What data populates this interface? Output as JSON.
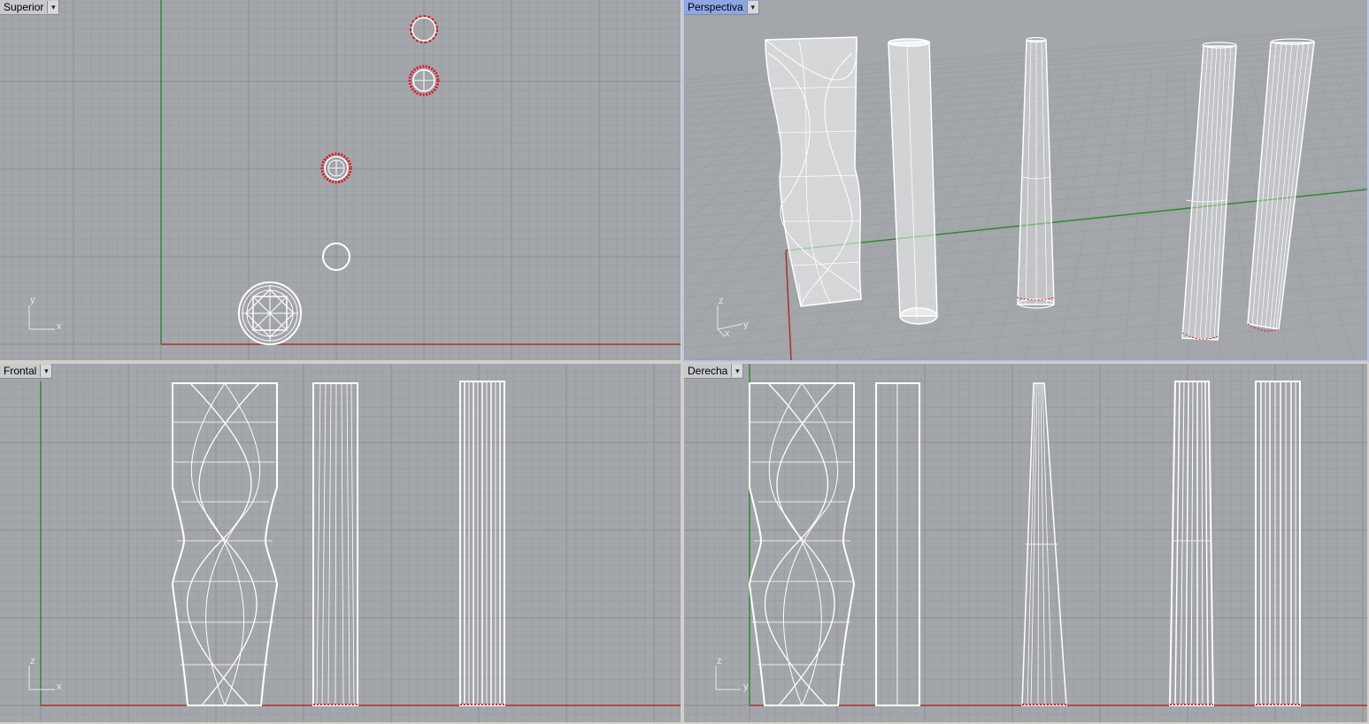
{
  "viewports": {
    "top": {
      "title": "Superior"
    },
    "persp": {
      "title": "Perspectiva"
    },
    "front": {
      "title": "Frontal"
    },
    "right": {
      "title": "Derecha"
    }
  },
  "axis_labels": {
    "top": {
      "a": "y",
      "b": "x"
    },
    "persp": {
      "a": "z",
      "b": "y",
      "c": "x"
    },
    "front": {
      "a": "z",
      "b": "x"
    },
    "right": {
      "a": "z",
      "b": "y"
    }
  },
  "dropdown_glyph": "▾",
  "colors": {
    "viewport_bg": "#a3a6ab",
    "grid_minor": "#999ca1",
    "grid_major": "#8c8f94",
    "x_axis": "#a8322b",
    "y_axis": "#2f8a2f",
    "geometry": "#ffffff",
    "selection": "#e0141c",
    "active_tab": "#8ea6e6"
  }
}
